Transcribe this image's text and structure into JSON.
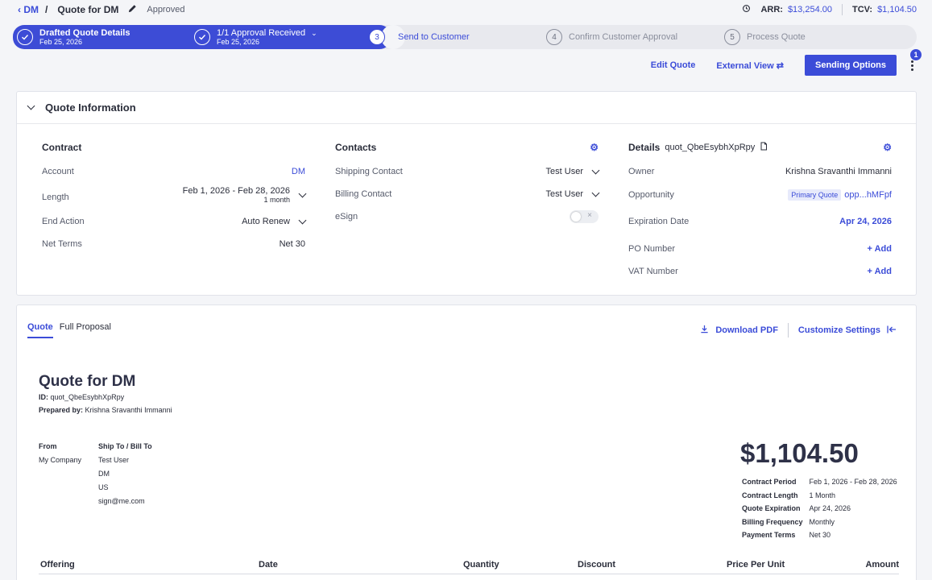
{
  "breadcrumb": {
    "back_label": "DM",
    "separator": "/",
    "title": "Quote for DM",
    "status": "Approved"
  },
  "metrics": {
    "arr_label": "ARR:",
    "arr_value": "$13,254.00",
    "tcv_label": "TCV:",
    "tcv_value": "$1,104.50"
  },
  "stepper": {
    "steps": [
      {
        "number": "1",
        "label": "Drafted Quote Details",
        "date": "Feb 25, 2026",
        "state": "done"
      },
      {
        "number": "2",
        "label": "1/1 Approval Received",
        "date": "Feb 25, 2026",
        "state": "done"
      },
      {
        "number": "3",
        "label": "Send to Customer",
        "date": "",
        "state": "active"
      },
      {
        "number": "4",
        "label": "Confirm Customer Approval",
        "date": "",
        "state": "todo"
      },
      {
        "number": "5",
        "label": "Process Quote",
        "date": "",
        "state": "todo"
      }
    ]
  },
  "actions": {
    "edit_quote": "Edit Quote",
    "external_view": "External View",
    "sending_options": "Sending Options",
    "notification_count": "1"
  },
  "quote_info": {
    "title": "Quote Information",
    "contract": {
      "heading": "Contract",
      "rows": [
        {
          "label": "Account",
          "value": "DM"
        },
        {
          "label": "Length",
          "value": "Feb 1, 2026 - Feb 28, 2026",
          "sub": "1 month"
        },
        {
          "label": "End Action",
          "value": "Auto Renew"
        },
        {
          "label": "Net Terms",
          "value": "Net 30"
        }
      ]
    },
    "contacts": {
      "heading": "Contacts",
      "rows": [
        {
          "label": "Shipping Contact",
          "value": "Test User"
        },
        {
          "label": "Billing Contact",
          "value": "Test User"
        },
        {
          "label": "eSign",
          "value": ""
        }
      ]
    },
    "details": {
      "heading": "Details",
      "quote_id": "quot_QbeEsybhXpRpy",
      "rows": [
        {
          "label": "Owner",
          "value": "Krishna Sravanthi Immanni"
        },
        {
          "label": "Opportunity",
          "tag": "Primary Quote",
          "value": "opp...hMFpf"
        },
        {
          "label": "Expiration Date",
          "value": "Apr 24, 2026"
        },
        {
          "label": "PO Number",
          "value": "+ Add"
        },
        {
          "label": "VAT Number",
          "value": "+ Add"
        }
      ]
    }
  },
  "quote_doc": {
    "tabs": [
      "Quote",
      "Full Proposal"
    ],
    "download_pdf": "Download PDF",
    "customize_settings": "Customize Settings",
    "title": "Quote for DM",
    "id_label": "ID:",
    "id_value": "quot_QbeEsybhXpRpy",
    "prepared_label": "Prepared by:",
    "prepared_value": "Krishna Sravanthi Immanni",
    "from_label": "From",
    "from_value": "My Company",
    "ship_label": "Ship To / Bill To",
    "ship_lines": [
      "Test User",
      "DM",
      "US",
      "sign@me.com"
    ],
    "total": "$1,104.50",
    "summary": [
      {
        "label": "Contract Period",
        "value": "Feb 1, 2026 - Feb 28, 2026"
      },
      {
        "label": "Contract Length",
        "value": "1 Month"
      },
      {
        "label": "Quote Expiration",
        "value": "Apr 24, 2026"
      },
      {
        "label": "Billing Frequency",
        "value": "Monthly"
      },
      {
        "label": "Payment Terms",
        "value": "Net 30"
      }
    ],
    "table_headers": [
      "Offering",
      "Date",
      "Quantity",
      "Discount",
      "Price Per Unit",
      "Amount"
    ]
  }
}
